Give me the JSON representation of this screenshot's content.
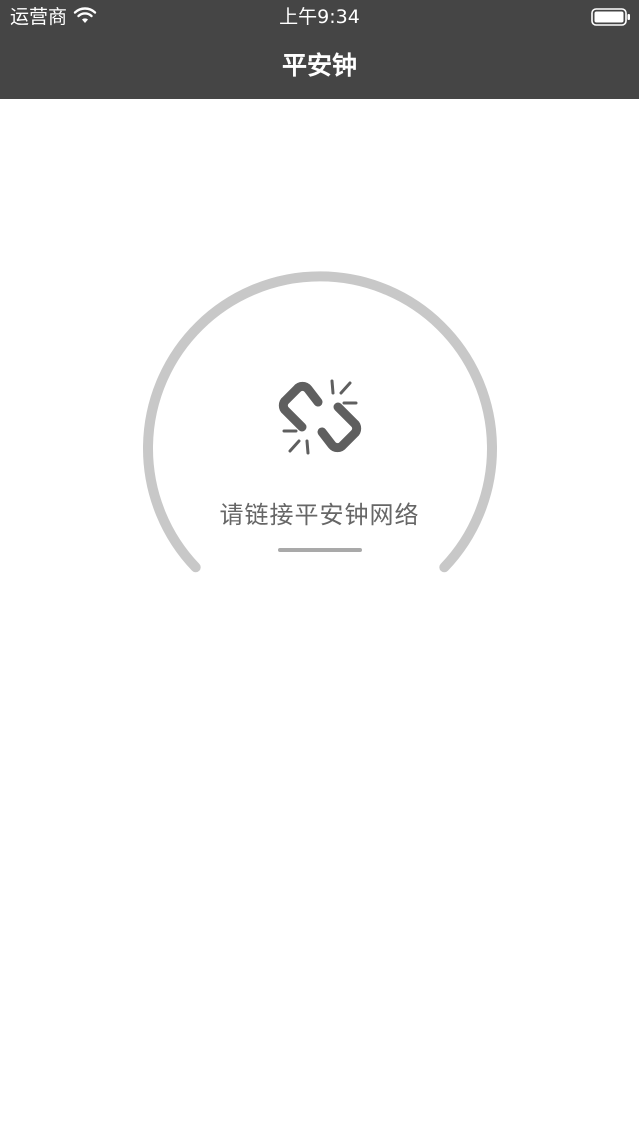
{
  "status_bar": {
    "carrier": "运营商",
    "time": "上午9:34",
    "wifi_icon": "wifi-icon",
    "battery_icon": "battery-icon"
  },
  "nav": {
    "title": "平安钟"
  },
  "main": {
    "status_icon": "broken-link-icon",
    "message": "请链接平安钟网络"
  },
  "colors": {
    "header_bg": "#454545",
    "gauge_track": "#c8c8c8",
    "icon": "#5f5f5f",
    "message_text": "#666666",
    "background": "#ffffff"
  }
}
